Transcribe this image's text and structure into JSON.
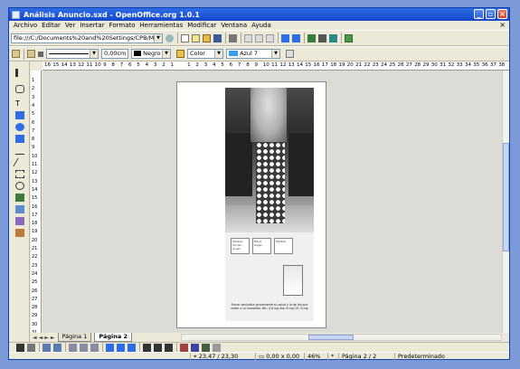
{
  "window": {
    "title": "Análisis Anuncio.sxd - OpenOffice.org 1.0.1"
  },
  "menu": [
    "Archivo",
    "Editar",
    "Ver",
    "Insertar",
    "Formato",
    "Herramientas",
    "Modificar",
    "Ventana",
    "Ayuda"
  ],
  "toolbar1": {
    "url": "file:///C:/Documents%20and%20Settings/CPB/Mis%20do"
  },
  "toolbar2": {
    "line_width": "0,00cm",
    "line_color": "Negro",
    "fill_type": "Color",
    "fill_color": "Azul 7"
  },
  "ruler": {
    "h_labels": [
      "16",
      "15",
      "14",
      "13",
      "12",
      "11",
      "10",
      "9",
      "8",
      "7",
      "6",
      "5",
      "4",
      "3",
      "2",
      "1",
      "",
      "1",
      "2",
      "3",
      "4",
      "5",
      "6",
      "7",
      "8",
      "9",
      "10",
      "11",
      "12",
      "13",
      "14",
      "15",
      "16",
      "17",
      "18",
      "19",
      "20",
      "21",
      "22",
      "23",
      "24",
      "25",
      "26",
      "27",
      "28",
      "29",
      "30",
      "31",
      "32",
      "33",
      "34",
      "35",
      "36",
      "37",
      "38"
    ],
    "v_labels": [
      "1",
      "2",
      "3",
      "4",
      "5",
      "6",
      "7",
      "8",
      "9",
      "10",
      "11",
      "12",
      "13",
      "14",
      "15",
      "16",
      "17",
      "18",
      "19",
      "20",
      "21",
      "22",
      "23",
      "24",
      "25",
      "26",
      "27",
      "28",
      "29",
      "30",
      "31"
    ]
  },
  "ad": {
    "box1": "Mostrar, Chi Jan Anger",
    "box2": "Filtrar Anger",
    "box3": "Mostrar",
    "caption": "Fumar perjudica gravemente su salud y la de los que están a su alrededor. Nic: 0,6 mg Alq: 8 mg CO: 9 mg"
  },
  "tabs": [
    {
      "label": "Página 1"
    },
    {
      "label": "Página 2"
    }
  ],
  "status": {
    "position": "23,47 / 23,30",
    "size": "0,00 x 0,00",
    "zoom": "46%",
    "page": "Página 2 / 2",
    "style": "Predeterminado"
  },
  "colors": {
    "titlebar": "#1447c9",
    "fill_swatch": "#3c9be6"
  }
}
